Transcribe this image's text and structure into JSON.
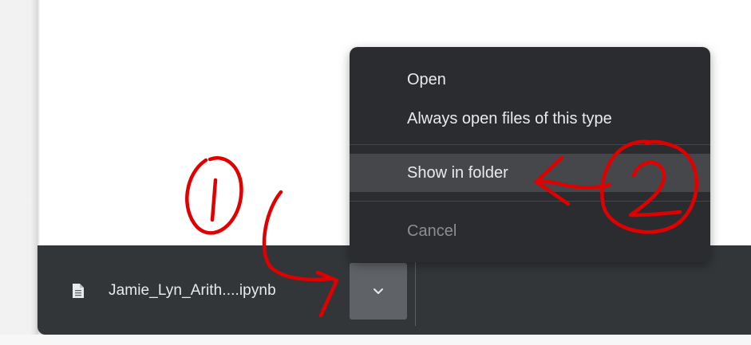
{
  "download_shelf": {
    "file_name": "Jamie_Lyn_Arith....ipynb",
    "file_icon": "file-icon",
    "menu_toggle_icon": "chevron-down-icon"
  },
  "context_menu": {
    "items": [
      {
        "label": "Open",
        "state": "normal"
      },
      {
        "label": "Always open files of this type",
        "state": "normal"
      },
      {
        "label": "Show in folder",
        "state": "highlighted"
      },
      {
        "label": "Cancel",
        "state": "disabled"
      }
    ]
  },
  "annotations": {
    "color": "#e00000",
    "marks": [
      {
        "label": "1",
        "meaning": "circled-number-one"
      },
      {
        "label": "2",
        "meaning": "circled-number-two"
      }
    ]
  },
  "colors": {
    "shelf_background": "#323639",
    "menu_background": "#2b2c2f",
    "menu_highlight": "#45474b",
    "button_background": "#5f6368",
    "annotation_red": "#e00000"
  }
}
